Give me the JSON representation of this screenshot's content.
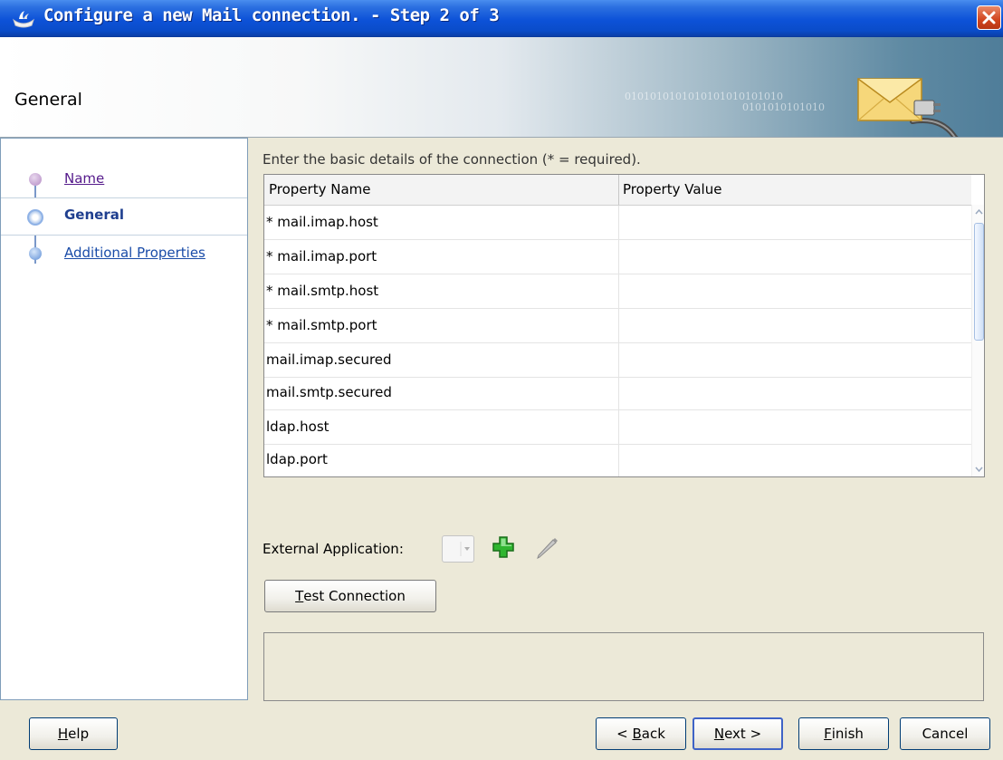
{
  "window": {
    "title": "Configure a new Mail connection. - Step 2 of 3"
  },
  "header": {
    "title": "General",
    "binary_text_1": "0101010101010101010101010",
    "binary_text_2": "0101010101010"
  },
  "sidebar": {
    "items": [
      {
        "label": "Name"
      },
      {
        "label": "General"
      },
      {
        "label": "Additional Properties"
      }
    ]
  },
  "main": {
    "intro": "Enter the basic details of the connection (* = required).",
    "table": {
      "columns": [
        "Property Name",
        "Property Value"
      ],
      "rows": [
        {
          "name": "* mail.imap.host",
          "value": ""
        },
        {
          "name": "* mail.imap.port",
          "value": ""
        },
        {
          "name": "* mail.smtp.host",
          "value": ""
        },
        {
          "name": "* mail.smtp.port",
          "value": ""
        },
        {
          "name": "mail.imap.secured",
          "value": ""
        },
        {
          "name": "mail.smtp.secured",
          "value": ""
        },
        {
          "name": "ldap.host",
          "value": ""
        },
        {
          "name": "ldap.port",
          "value": ""
        }
      ]
    },
    "external_app": {
      "label": "External Application:",
      "add_icon": "plus-icon",
      "edit_icon": "pencil-icon"
    },
    "test_connection": {
      "mnemonic": "T",
      "rest": "est Connection"
    }
  },
  "footer": {
    "help": {
      "mnemonic": "H",
      "rest": "elp"
    },
    "back": {
      "prefix": "< ",
      "mnemonic": "B",
      "rest": "ack"
    },
    "next": {
      "mnemonic": "N",
      "rest": "ext >"
    },
    "finish": {
      "mnemonic": "F",
      "rest": "inish"
    },
    "cancel": {
      "label": "Cancel"
    }
  },
  "colors": {
    "titlebar": "#0d52d8",
    "link_visited": "#551a8b",
    "link": "#1a4ca8",
    "add_icon": "#1fa81f"
  }
}
